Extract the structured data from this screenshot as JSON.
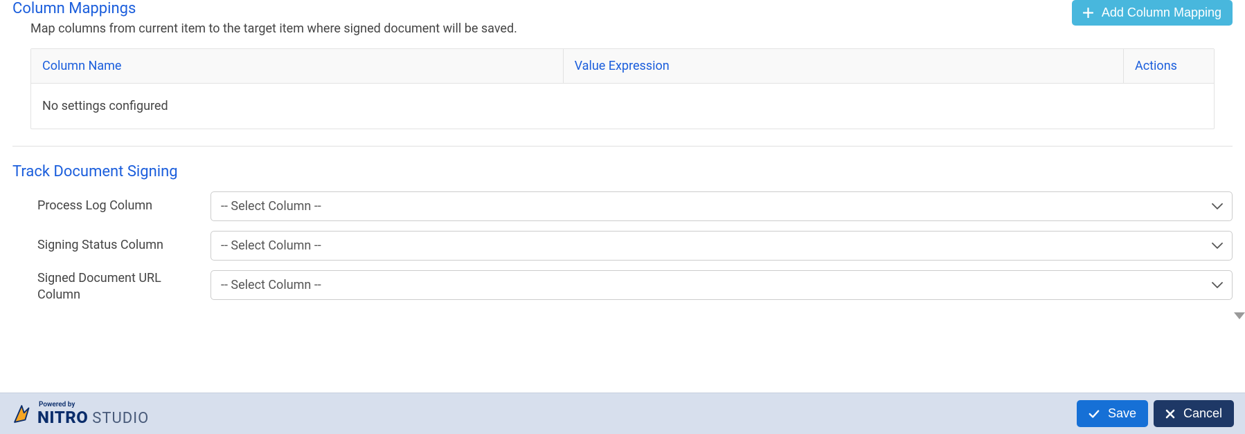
{
  "columnMappings": {
    "title": "Column Mappings",
    "description": "Map columns from current item to the target item where signed document will be saved.",
    "addButtonLabel": "Add Column Mapping",
    "columns": {
      "name": "Column Name",
      "expr": "Value Expression",
      "actions": "Actions"
    },
    "emptyMessage": "No settings configured"
  },
  "trackSigning": {
    "title": "Track Document Signing",
    "fields": {
      "processLog": {
        "label": "Process Log Column",
        "value": "-- Select Column --"
      },
      "signingStatus": {
        "label": "Signing Status Column",
        "value": "-- Select Column --"
      },
      "signedUrl": {
        "label": "Signed Document URL Column",
        "value": "-- Select Column --"
      }
    }
  },
  "footer": {
    "poweredBy": "Powered by",
    "brandBold": "NITRO",
    "brandLight": "STUDIO",
    "save": "Save",
    "cancel": "Cancel"
  }
}
